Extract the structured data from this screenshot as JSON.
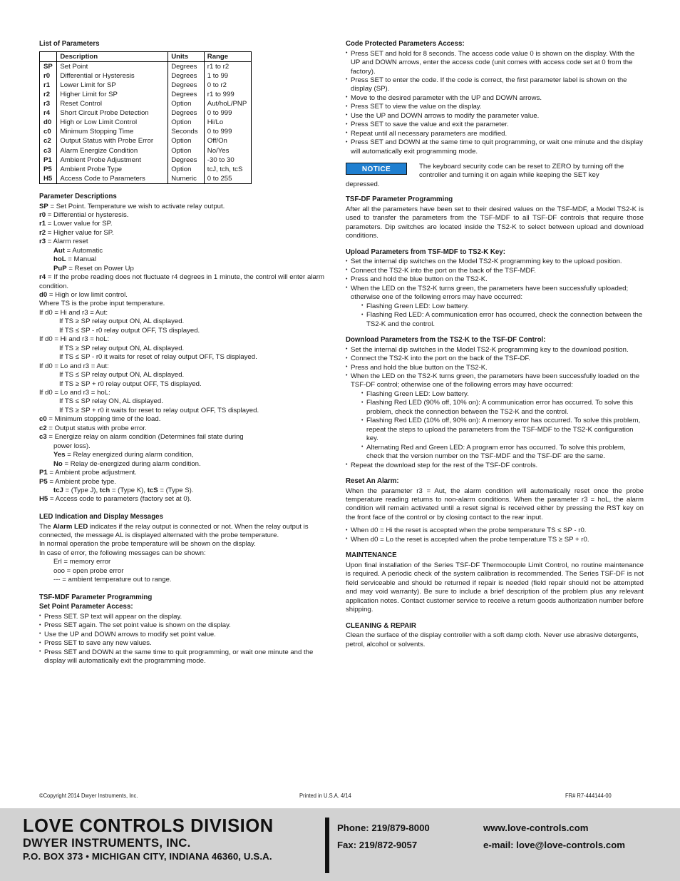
{
  "colors": {
    "notice_blue": "#1f7fd0",
    "band_gray": "#d2d2d2",
    "ink": "#1a1a1a"
  },
  "left": {
    "table_title": "List of Parameters",
    "table": {
      "headers": [
        "",
        "Description",
        "Units",
        "Range"
      ],
      "rows": [
        [
          "SP",
          "Set Point",
          "Degrees",
          "r1 to r2"
        ],
        [
          "r0",
          "Differential or Hysteresis",
          "Degrees",
          "1 to 99"
        ],
        [
          "r1",
          "Lower Limit for SP",
          "Degrees",
          "0 to r2"
        ],
        [
          "r2",
          "Higher Limit for SP",
          "Degrees",
          "r1 to 999"
        ],
        [
          "r3",
          "Reset Control",
          "Option",
          "Aut/hoL/PNP"
        ],
        [
          "r4",
          "Short Circuit Probe Detection",
          "Degrees",
          "0 to 999"
        ],
        [
          "d0",
          "High or Low Limit Control",
          "Option",
          "Hi/Lo"
        ],
        [
          "c0",
          "Minimum Stopping Time",
          "Seconds",
          "0 to 999"
        ],
        [
          "c2",
          "Output Status with Probe Error",
          "Option",
          "Off/On"
        ],
        [
          "c3",
          "Alarm Energize Condition",
          "Option",
          "No/Yes"
        ],
        [
          "P1",
          "Ambient Probe Adjustment",
          "Degrees",
          "-30 to 30"
        ],
        [
          "P5",
          "Ambient Probe Type",
          "Option",
          "tcJ, tch, tcS"
        ],
        [
          "H5",
          "Access Code to Parameters",
          "Numeric",
          "0 to 255"
        ]
      ]
    },
    "param_desc": {
      "title": "Parameter Descriptions",
      "sp": "<b>SP</b> = Set Point. Temperature we wish to activate relay output.",
      "r0": "<b>r0</b> = Differential or hysteresis.",
      "r1": "<b>r1</b> = Lower value for SP.",
      "r2": "<b>r2</b> = Higher value for SP.",
      "r3": "<b>r3</b> = Alarm reset",
      "r3_aut": "<b>Aut</b> = Automatic",
      "r3_hol": "<b>hoL</b> = Manual",
      "r3_pup": "<b>PuP</b> = Reset on Power Up",
      "r4": "<b>r4</b> = If the probe reading does not fluctuate r4 degrees in 1 minute, the control will enter alarm condition.",
      "d0": "<b>d0</b> = High or low limit control.",
      "ts_note": "Where TS is the probe input temperature.",
      "cond_hi_aut": "If d0 = Hi and r3 = Aut:",
      "cond_hi_aut_1": "If TS ≥ SP relay output ON, AL displayed.",
      "cond_hi_aut_2": "If TS ≤ SP - r0 relay output OFF, TS displayed.",
      "cond_hi_hol": "If d0 = Hi and r3 = hoL:",
      "cond_hi_hol_1": "If TS ≥ SP relay output ON, AL displayed.",
      "cond_hi_hol_2": "If TS ≤ SP - r0 it waits for reset of relay output OFF, TS displayed.",
      "cond_lo_aut": "If d0 = Lo and r3 = Aut:",
      "cond_lo_aut_1": "If TS ≤ SP relay output ON, AL displayed.",
      "cond_lo_aut_2": "If TS ≥ SP + r0 relay output OFF, TS displayed.",
      "cond_lo_hol": "If d0 = Lo and r3 = hoL:",
      "cond_lo_hol_1": "If TS ≤ SP relay ON, AL displayed.",
      "cond_lo_hol_2": "If TS ≥ SP + r0 it waits for reset to relay output OFF, TS displayed.",
      "c0": "<b>c0</b> = Minimum stopping time of the load.",
      "c2": "<b>c2</b> = Output status with probe error.",
      "c3": "<b>c3</b> = Energize relay on alarm condition (Determines fail state during",
      "c3_cont": "power loss).",
      "c3_yes": "<b>Yes</b> = Relay energized during alarm condition,",
      "c3_no": "<b>No</b> = Relay de-energized during alarm condition.",
      "p1": "<b>P1</b> = Ambient probe adjustment.",
      "p5": "<b>P5</b> = Ambient probe type.",
      "p5_types": "<b>tcJ</b> = (Type J), <b>tch</b> = (Type K), <b>tcS</b> = (Type S).",
      "h5": "<b>H5</b> = Access code to parameters (factory set at 0)."
    },
    "led": {
      "title": "LED Indication and Display Messages",
      "p1": "The <b>Alarm LED</b> indicates if the relay output is connected or not. When the relay output is connected, the message AL is displayed alternated with the probe temperature.",
      "p2": "In normal operation the probe temperature will be shown on the display.",
      "p3": "In case of error, the following messages can be shown:",
      "e1": "Erl = memory error",
      "e2": "ooo = open probe error",
      "e3": "--- = ambient temperature out to range."
    },
    "mdf": {
      "title": "TSF-MDF Parameter Programming",
      "subtitle": "Set Point Parameter Access:",
      "bullets": [
        "Press SET. SP text will appear on the display.",
        "Press SET again. The set point value is shown on the display.",
        "Use the UP and DOWN arrows to modify set point value.",
        "Press SET to save any new values.",
        "Press SET and DOWN at the same time to quit programming, or wait one minute and the display will automatically exit the programming mode."
      ]
    }
  },
  "right": {
    "code_access": {
      "title": "Code Protected Parameters Access:",
      "bullets": [
        "Press SET and hold for 8 seconds. The access code value 0 is shown on the display. With the UP and DOWN arrows, enter the access code (unit comes with access code set at 0 from the factory).",
        "Press SET to enter the code. If the code is correct, the first parameter label is shown on the display (SP).",
        "Move to the desired parameter with the UP and DOWN arrows.",
        "Press SET to view the value on the display.",
        "Use the UP and DOWN arrows to modify the parameter value.",
        "Press SET to save the value and exit the parameter.",
        "Repeat until all necessary parameters are modified.",
        "Press SET and DOWN at the same time to quit programming, or wait one minute and the display will automatically exit programming mode."
      ]
    },
    "notice": {
      "badge": "NOTICE",
      "text": "The keyboard security code can be reset to ZERO by turning off the controller and turning it on again while keeping the SET key",
      "tail": "depressed."
    },
    "tsf_df": {
      "title": "TSF-DF Parameter Programming",
      "body": "After all the parameters have been set to their desired values on the TSF-MDF, a Model TS2-K is used to transfer the parameters from the TSF-MDF to all TSF-DF controls that require those parameters. Dip switches are located inside the TS2-K to select between upload and download conditions."
    },
    "upload": {
      "title": "Upload Parameters from TSF-MDF to TS2-K Key:",
      "bullets": [
        "Set the internal dip switches on the Model TS2-K programming key to the upload position.",
        "Connect the TS2-K into the port on the back of the TSF-MDF.",
        "Press and hold the blue button on the TS2-K.",
        "When the LED on the TS2-K turns green, the parameters have been successfully uploaded; otherwise one of the following errors may have occurred:"
      ],
      "sub_bullets": [
        "Flashing Green LED: Low battery.",
        "Flashing Red LED: A communication error has occurred, check the connection between the TS2-K and the control."
      ]
    },
    "download": {
      "title": "Download Parameters from the TS2-K to the TSF-DF Control:",
      "bullets": [
        "Set the internal dip switches in the Model TS2-K programming key to the download position.",
        "Connect the TS2-K into the port on the back of the TSF-DF.",
        "Press and hold the blue button on the TS2-K.",
        "When the LED on the TS2-K turns green, the parameters have been successfully loaded on the TSF-DF control; otherwise one of the following errors may have occurred:"
      ],
      "sub_bullets": [
        "Flashing Green LED: Low battery.",
        "Flashing Red LED (90% off, 10% on): A communication error has occurred. To solve this problem, check the connection between the TS2-K and the control.",
        "Flashing Red LED (10% off, 90% on): A memory error has occurred. To solve this problem, repeat the steps to upload the parameters from the TSF-MDF to the TS2-K configuration key.",
        "Alternating Red and Green LED: A program error has occurred. To solve this problem, check that the version number on the TSF-MDF and the TSF-DF are the same."
      ],
      "final_bullet": "Repeat the download step for the rest of the TSF-DF controls."
    },
    "reset_alarm": {
      "title": "Reset An Alarm:",
      "body": "When the parameter r3 = Aut, the alarm condition will automatically reset once the probe temperature reading returns to non-alarm conditions. When the parameter r3 = hoL, the alarm condition will remain activated until a reset signal is received either by pressing the RST key on the front face of the control or by closing contact to the rear input.",
      "bullets": [
        "When d0 = Hi the reset is accepted when the probe temperature TS ≤ SP - r0.",
        "When d0 = Lo the reset is accepted when the probe temperature TS ≥ SP + r0."
      ]
    },
    "maintenance": {
      "title": "MAINTENANCE",
      "body": "Upon final installation of the Series TSF-DF Thermocouple Limit Control, no routine maintenance is required. A periodic check of the system calibration is recommended. The Series TSF-DF is not field serviceable and should be returned if repair is needed (field repair should not be attempted and may void warranty). Be sure to include a brief description of the problem plus any relevant application notes. Contact customer service to receive a return goods authorization number before shipping."
    },
    "cleaning": {
      "title": "CLEANING & REPAIR",
      "body": "Clean the surface of the display controller with a soft damp cloth. Never use abrasive detergents, petrol, alcohol or solvents."
    }
  },
  "meta": {
    "copyright": "©Copyright 2014 Dwyer Instruments, Inc.",
    "printed": "Printed in U.S.A. 4/14",
    "fr": "FR# R7-444144-00"
  },
  "band": {
    "line1": "LOVE CONTROLS DIVISION",
    "line2": "DWYER INSTRUMENTS, INC.",
    "line3": "P.O. BOX 373 • MICHIGAN CITY, INDIANA 46360, U.S.A.",
    "phone_label": "Phone: 219/879-8000",
    "fax_label": "Fax: 219/872-9057",
    "website": "www.love-controls.com",
    "email": "e-mail: love@love-controls.com"
  }
}
